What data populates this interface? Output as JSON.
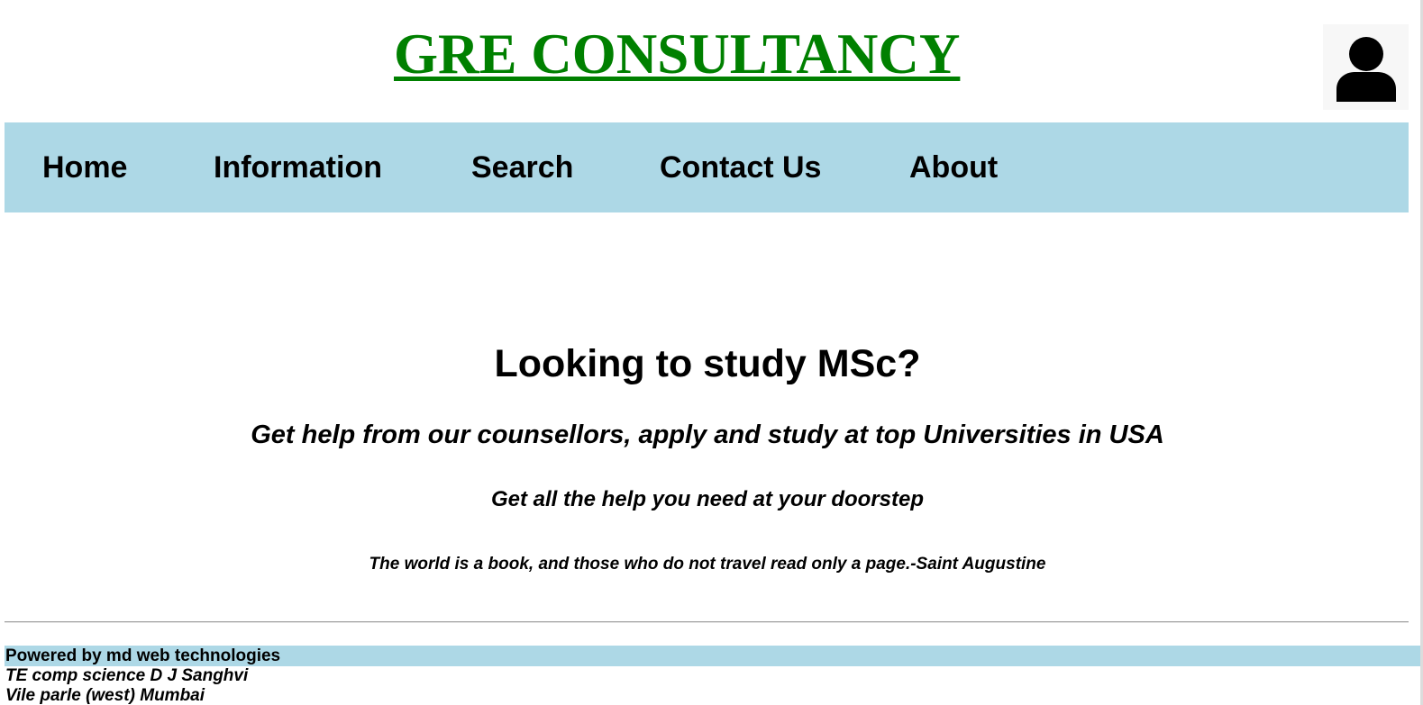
{
  "header": {
    "site_title": "GRE CONSULTANCY",
    "avatar_icon": "user-icon"
  },
  "nav": {
    "items": [
      {
        "label": "Home"
      },
      {
        "label": "Information"
      },
      {
        "label": "Search"
      },
      {
        "label": "Contact Us"
      },
      {
        "label": "About"
      }
    ],
    "background": "#add8e6"
  },
  "hero": {
    "title": "Looking to study MSc?",
    "subtitle": "Get help from our counsellors, apply and study at top Universities in USA",
    "tagline": "Get all the help you need at your doorstep",
    "quote": "The world is a book, and those who do not travel read only a page.-Saint Augustine"
  },
  "footer": {
    "powered_by": "Powered by md web technologies",
    "line1": "TE comp science D J Sanghvi",
    "line2": "Vile parle (west) Mumbai"
  },
  "colors": {
    "title_green": "#008000",
    "nav_blue": "#add8e6"
  }
}
